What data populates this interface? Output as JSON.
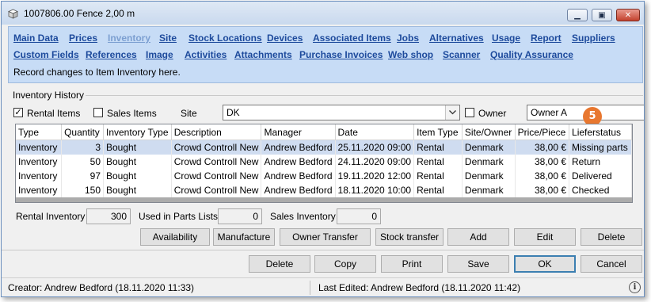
{
  "window": {
    "title": "1007806.00 Fence 2,00 m",
    "minimize_glyph": "▁",
    "maximize_glyph": "▣",
    "close_glyph": "✕"
  },
  "nav": {
    "row1": [
      {
        "label": "Main Data",
        "active": false
      },
      {
        "label": "Prices",
        "active": false
      },
      {
        "label": "Inventory",
        "active": true
      },
      {
        "label": "Site",
        "active": false
      },
      {
        "label": "Stock Locations",
        "active": false
      },
      {
        "label": "Devices",
        "active": false
      },
      {
        "label": "Associated Items",
        "active": false
      },
      {
        "label": "Jobs",
        "active": false
      },
      {
        "label": "Alternatives",
        "active": false
      },
      {
        "label": "Usage",
        "active": false
      },
      {
        "label": "Report",
        "active": false
      },
      {
        "label": "Suppliers",
        "active": false
      }
    ],
    "row2": [
      {
        "label": "Custom Fields"
      },
      {
        "label": "References"
      },
      {
        "label": "Image"
      },
      {
        "label": "Activities"
      },
      {
        "label": "Attachments"
      },
      {
        "label": "Purchase Invoices"
      },
      {
        "label": "Web shop"
      },
      {
        "label": "Scanner"
      },
      {
        "label": "Quality Assurance"
      }
    ],
    "hint": "Record changes to Item Inventory here."
  },
  "inventory_history": {
    "section_label": "Inventory History",
    "rental_items_label": "Rental Items",
    "rental_items_checked": true,
    "sales_items_label": "Sales Items",
    "sales_items_checked": false,
    "site_label": "Site",
    "site_value": "DK",
    "owner_label": "Owner",
    "owner_checked": false,
    "owner_value": "Owner A",
    "badge": "5",
    "checkmark": "✓"
  },
  "grid": {
    "columns": [
      "Type",
      "Quantity",
      "Inventory Type",
      "Description",
      "Manager",
      "Date",
      "Item Type",
      "Site/Owner",
      "Price/Piece",
      "Lieferstatus"
    ],
    "rows": [
      [
        "Inventory",
        "3",
        "Bought",
        "Crowd Controll New",
        "Andrew Bedford",
        "25.11.2020 09:00",
        "Rental",
        "Denmark",
        "38,00 €",
        "Missing parts"
      ],
      [
        "Inventory",
        "50",
        "Bought",
        "Crowd Controll New",
        "Andrew Bedford",
        "24.11.2020 09:00",
        "Rental",
        "Denmark",
        "38,00 €",
        "Return"
      ],
      [
        "Inventory",
        "97",
        "Bought",
        "Crowd Controll New",
        "Andrew Bedford",
        "19.11.2020 12:00",
        "Rental",
        "Denmark",
        "38,00 €",
        "Delivered"
      ],
      [
        "Inventory",
        "150",
        "Bought",
        "Crowd Controll New",
        "Andrew Bedford",
        "18.11.2020 10:00",
        "Rental",
        "Denmark",
        "38,00 €",
        "Checked"
      ]
    ],
    "selected_row": 0
  },
  "totals": {
    "rental_inventory_label": "Rental Inventory",
    "rental_inventory_value": "300",
    "used_in_parts_label": "Used in Parts Lists",
    "used_in_parts_value": "0",
    "sales_inventory_label": "Sales Inventory",
    "sales_inventory_value": "0"
  },
  "grid_actions": {
    "availability": "Availability",
    "manufacture": "Manufacture",
    "owner_transfer": "Owner Transfer",
    "stock_transfer": "Stock transfer",
    "add": "Add",
    "edit": "Edit",
    "delete": "Delete"
  },
  "dialog_actions": {
    "delete": "Delete",
    "copy": "Copy",
    "print": "Print",
    "save": "Save",
    "ok": "OK",
    "cancel": "Cancel"
  },
  "status": {
    "creator": "Creator: Andrew Bedford (18.11.2020 11:33)",
    "last_edited": "Last Edited:  Andrew Bedford (18.11.2020 11:42)",
    "info_glyph": "i"
  }
}
